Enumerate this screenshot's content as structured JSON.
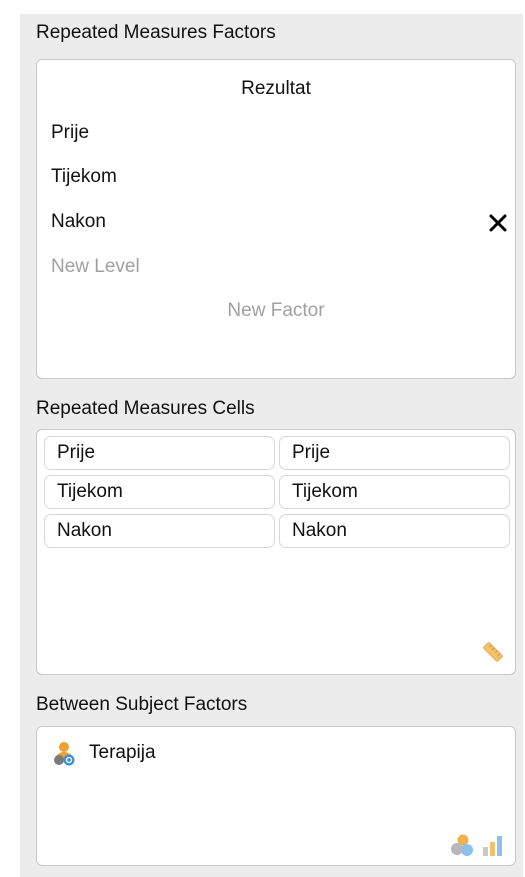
{
  "repeated_measures_factors": {
    "title": "Repeated Measures Factors",
    "factor_name": "Rezultat",
    "levels": [
      "Prije",
      "Tijekom",
      "Nakon"
    ],
    "new_level_placeholder": "New Level",
    "new_factor_placeholder": "New Factor"
  },
  "repeated_measures_cells": {
    "title": "Repeated Measures Cells",
    "rows": [
      {
        "left": "Prije",
        "right": "Prije"
      },
      {
        "left": "Tijekom",
        "right": "Tijekom"
      },
      {
        "left": "Nakon",
        "right": "Nakon"
      }
    ],
    "icon": "ruler-icon"
  },
  "between_subject_factors": {
    "title": "Between Subject Factors",
    "variables": [
      "Terapija"
    ],
    "variable_icon": "nominal-variable-icon",
    "allowed_type_icons": [
      "nominal-icon",
      "ordinal-icon"
    ]
  },
  "colors": {
    "panel_bg": "#ececec",
    "box_bg": "#ffffff",
    "placeholder_text": "#a0a0a0",
    "nominal_orange": "#f0a030",
    "nominal_blue": "#3a8fd8",
    "ruler_yellow": "#f5c26b"
  }
}
